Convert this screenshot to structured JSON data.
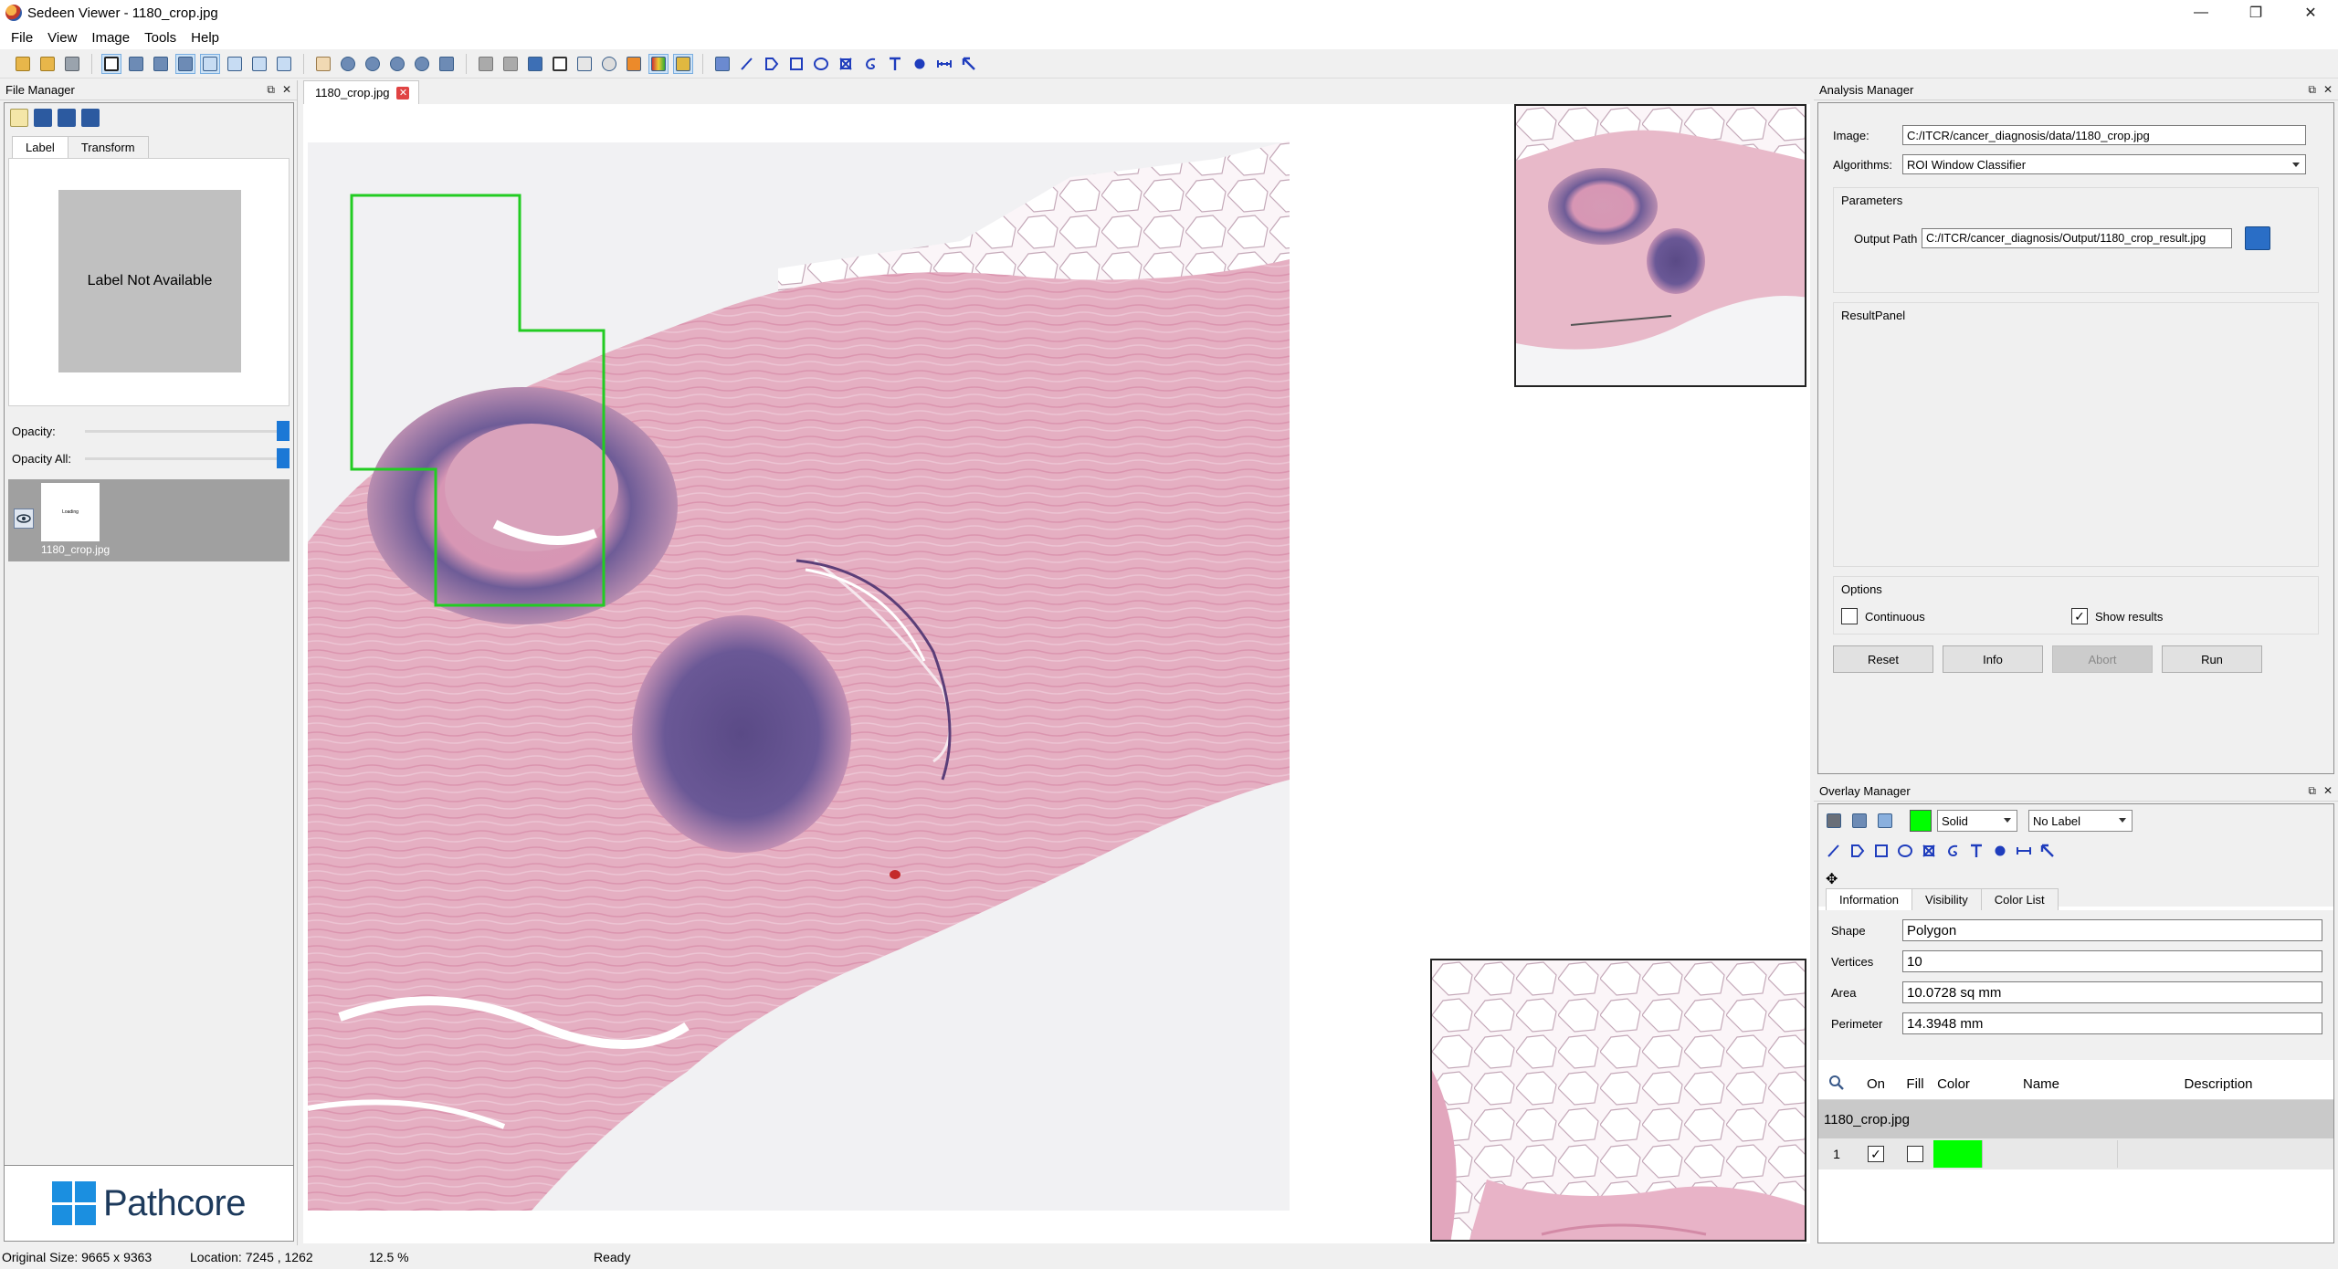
{
  "window": {
    "title": "Sedeen Viewer - 1180_crop.jpg",
    "minimize": "—",
    "maximize": "❐",
    "close": "✕"
  },
  "menu": [
    "File",
    "View",
    "Image",
    "Tools",
    "Help"
  ],
  "file_manager": {
    "title": "File Manager",
    "tabs": [
      "Label",
      "Transform"
    ],
    "label_text": "Label Not Available",
    "opacity_label": "Opacity:",
    "opacity_all_label": "Opacity All:",
    "opacity_value": 1.0,
    "opacity_all_value": 1.0,
    "file_name": "1180_crop.jpg",
    "thumb_text": "Loading",
    "logo_text": "Pathcore"
  },
  "viewer": {
    "tab_name": "1180_crop.jpg",
    "roi_color": "#22cc22"
  },
  "analysis_manager": {
    "title": "Analysis Manager",
    "image_label": "Image:",
    "image_value": "C:/ITCR/cancer_diagnosis/data/1180_crop.jpg",
    "algorithms_label": "Algorithms:",
    "algorithms_value": "ROI Window Classifier",
    "parameters_title": "Parameters",
    "output_path_label": "Output Path",
    "output_path_value": "C:/ITCR/cancer_diagnosis/Output/1180_crop_result.jpg",
    "result_panel_title": "ResultPanel",
    "options_title": "Options",
    "continuous_label": "Continuous",
    "continuous_checked": false,
    "show_results_label": "Show results",
    "show_results_checked": true,
    "buttons": {
      "reset": "Reset",
      "info": "Info",
      "abort": "Abort",
      "run": "Run"
    }
  },
  "overlay_manager": {
    "title": "Overlay Manager",
    "line_style": "Solid",
    "label_select": "No Label",
    "color": "#00ff00",
    "tabs": [
      "Information",
      "Visibility",
      "Color List"
    ],
    "info": {
      "shape_label": "Shape",
      "shape_value": "Polygon",
      "vertices_label": "Vertices",
      "vertices_value": "10",
      "area_label": "Area",
      "area_value": "10.0728 sq mm",
      "perimeter_label": "Perimeter",
      "perimeter_value": "14.3948 mm"
    },
    "table_headers": [
      "On",
      "Fill",
      "Color",
      "Name",
      "Description"
    ],
    "group_name": "1180_crop.jpg",
    "rows": [
      {
        "index": "1",
        "on": true,
        "fill": false,
        "color": "#00ff00",
        "name": "",
        "description": ""
      }
    ]
  },
  "status": {
    "original_size": "Original Size: 9665 x 9363",
    "location": "Location: 7245 , 1262",
    "zoom": "12.5 %",
    "state": "Ready"
  }
}
